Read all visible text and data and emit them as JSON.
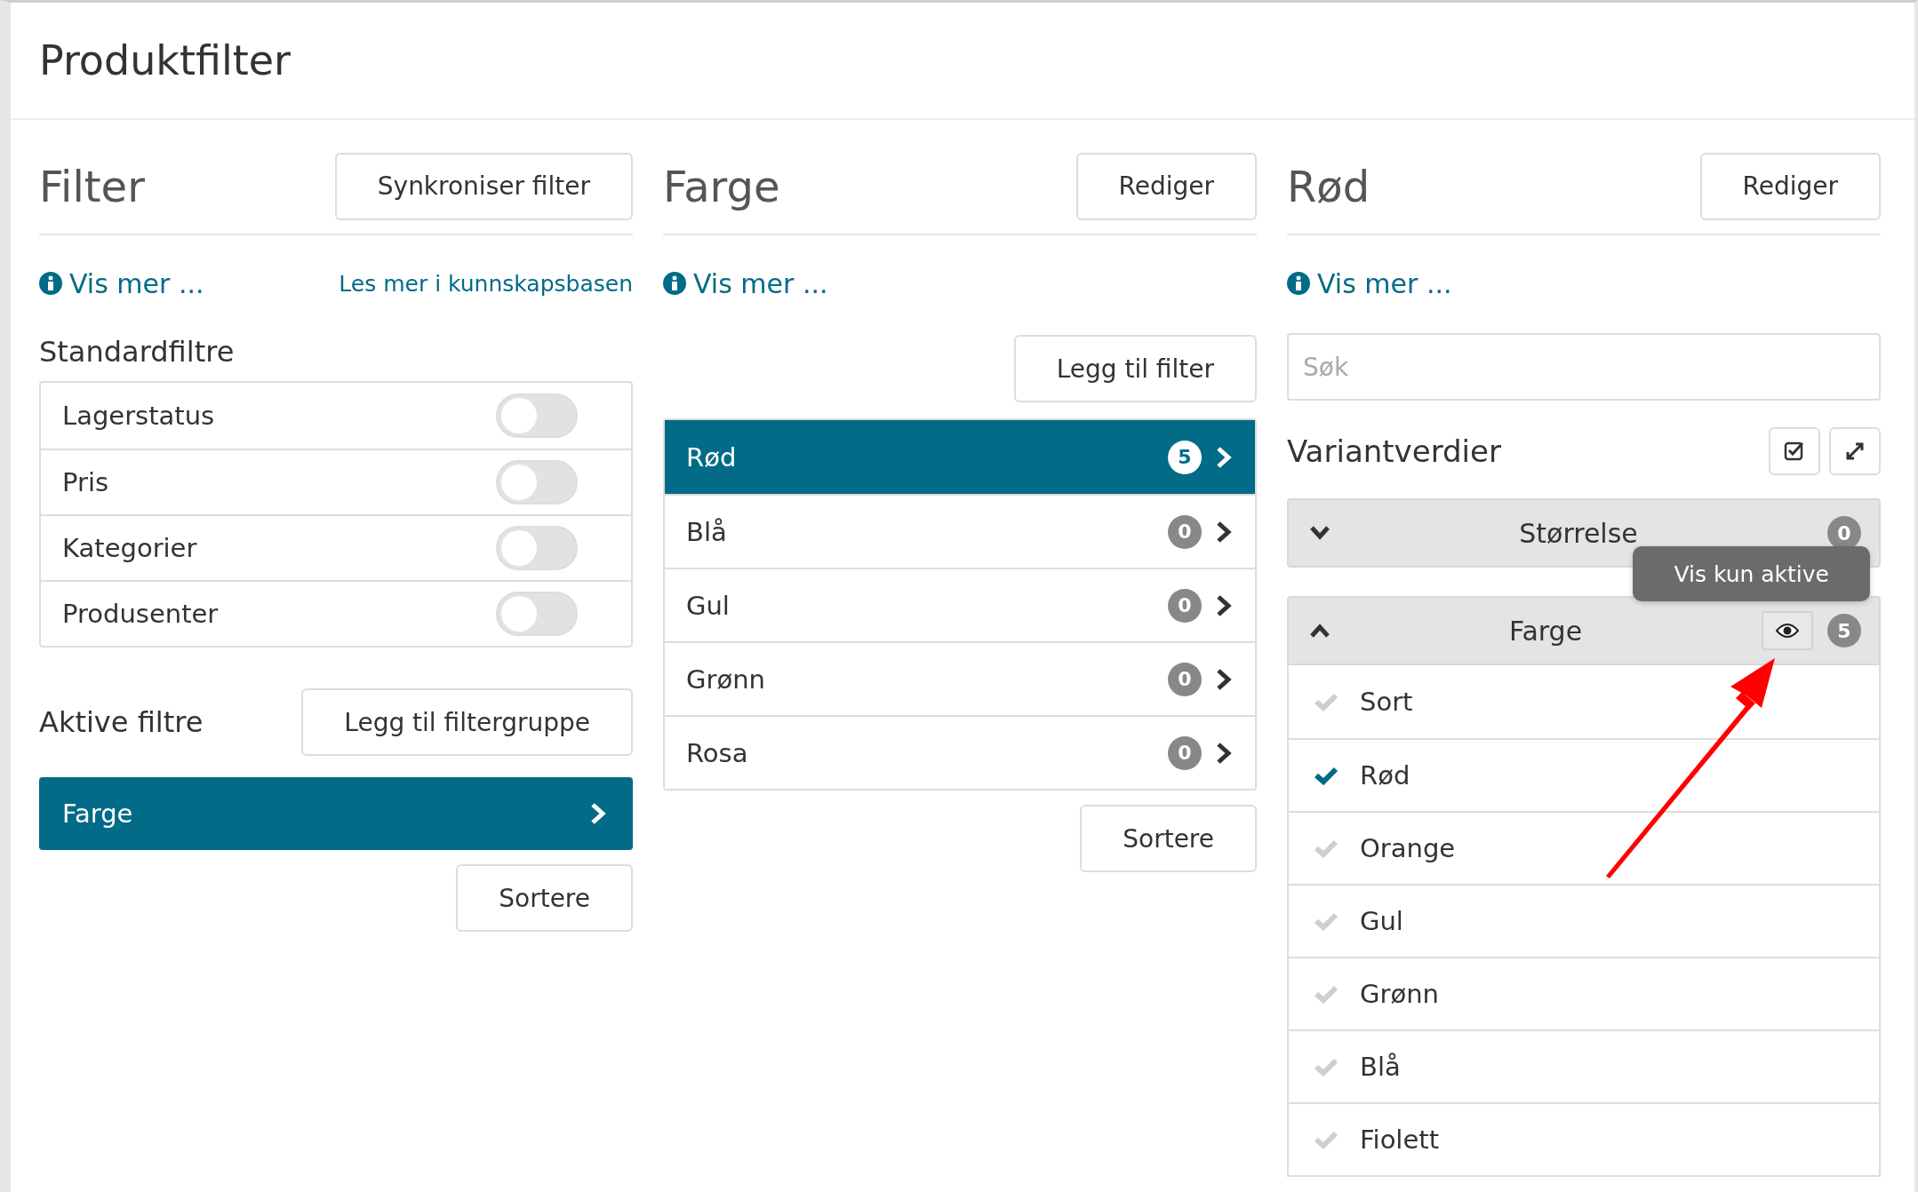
{
  "page": {
    "title": "Produktfilter"
  },
  "filter_panel": {
    "title": "Filter",
    "action": "Synkroniser filter",
    "info_link": "Vis mer ...",
    "kb_link": "Les mer i kunnskapsbasen",
    "standard_heading": "Standardfiltre",
    "standard_filters": [
      {
        "label": "Lagerstatus",
        "on": false
      },
      {
        "label": "Pris",
        "on": false
      },
      {
        "label": "Kategorier",
        "on": false
      },
      {
        "label": "Produsenter",
        "on": false
      }
    ],
    "active_heading": "Aktive filtre",
    "add_group": "Legg til filtergruppe",
    "active_filters": [
      {
        "label": "Farge",
        "selected": true
      }
    ],
    "sort": "Sortere"
  },
  "group_panel": {
    "title": "Farge",
    "action": "Rediger",
    "info_link": "Vis mer ...",
    "add": "Legg til filter",
    "values": [
      {
        "label": "Rød",
        "count": "5",
        "selected": true
      },
      {
        "label": "Blå",
        "count": "0",
        "selected": false
      },
      {
        "label": "Gul",
        "count": "0",
        "selected": false
      },
      {
        "label": "Grønn",
        "count": "0",
        "selected": false
      },
      {
        "label": "Rosa",
        "count": "0",
        "selected": false
      }
    ],
    "sort": "Sortere"
  },
  "value_panel": {
    "title": "Rød",
    "action": "Rediger",
    "info_link": "Vis mer ...",
    "search": {
      "placeholder": "Søk"
    },
    "variants_heading": "Variantverdier",
    "groups": [
      {
        "label": "Størrelse",
        "count": "0",
        "expanded": false
      },
      {
        "label": "Farge",
        "count": "5",
        "expanded": true,
        "tooltip": "Vis kun aktive",
        "items": [
          {
            "label": "Sort",
            "checked": false
          },
          {
            "label": "Rød",
            "checked": true
          },
          {
            "label": "Orange",
            "checked": false
          },
          {
            "label": "Gul",
            "checked": false
          },
          {
            "label": "Grønn",
            "checked": false
          },
          {
            "label": "Blå",
            "checked": false
          },
          {
            "label": "Fiolett",
            "checked": false
          }
        ]
      }
    ]
  }
}
